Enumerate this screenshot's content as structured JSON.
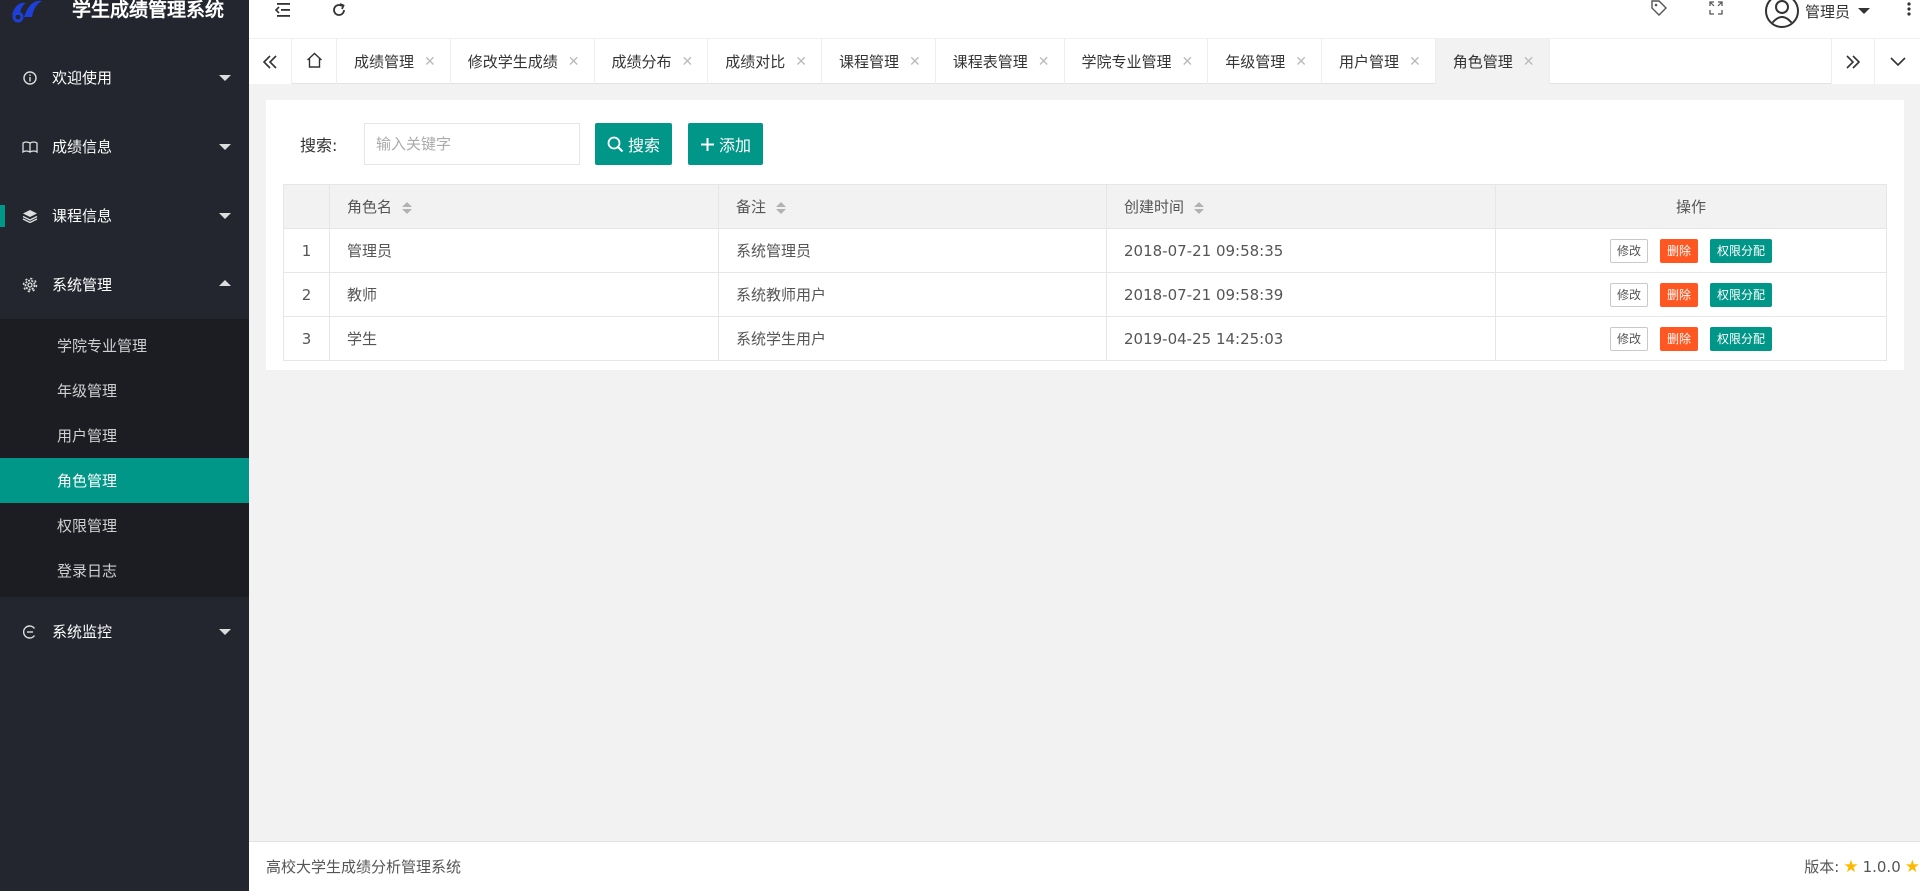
{
  "app": {
    "title": "学生成绩管理系统"
  },
  "sidebar": {
    "groups": [
      {
        "label": "欢迎使用",
        "icon": "info-icon"
      },
      {
        "label": "成绩信息",
        "icon": "book-icon"
      },
      {
        "label": "课程信息",
        "icon": "layers-icon"
      },
      {
        "label": "系统管理",
        "icon": "gear-icon"
      },
      {
        "label": "系统监控",
        "icon": "monitor-icon"
      }
    ],
    "sub_items": [
      "学院专业管理",
      "年级管理",
      "用户管理",
      "角色管理",
      "权限管理",
      "登录日志"
    ],
    "active_sub": "角色管理"
  },
  "header": {
    "user": "管理员"
  },
  "tabs": [
    {
      "label": "成绩管理"
    },
    {
      "label": "修改学生成绩"
    },
    {
      "label": "成绩分布"
    },
    {
      "label": "成绩对比"
    },
    {
      "label": "课程管理"
    },
    {
      "label": "课程表管理"
    },
    {
      "label": "学院专业管理"
    },
    {
      "label": "年级管理"
    },
    {
      "label": "用户管理"
    },
    {
      "label": "角色管理"
    }
  ],
  "search": {
    "label": "搜索:",
    "placeholder": "输入关键字",
    "search_btn": "搜索",
    "add_btn": "添加"
  },
  "table": {
    "headers": [
      "角色名",
      "备注",
      "创建时间",
      "操作"
    ],
    "rows": [
      {
        "no": "1",
        "name": "管理员",
        "note": "系统管理员",
        "created": "2018-07-21 09:58:35"
      },
      {
        "no": "2",
        "name": "教师",
        "note": "系统教师用户",
        "created": "2018-07-21 09:58:39"
      },
      {
        "no": "3",
        "name": "学生",
        "note": "系统学生用户",
        "created": "2019-04-25 14:25:03"
      }
    ],
    "actions": {
      "edit": "修改",
      "delete": "删除",
      "perm": "权限分配"
    }
  },
  "footer": {
    "text": "高校大学生成绩分析管理系统",
    "version_label": "版本:",
    "version": "1.0.0"
  },
  "colors": {
    "accent": "#009688",
    "danger": "#ff5722",
    "sidebar": "#23262e",
    "star": "#ffb800"
  }
}
